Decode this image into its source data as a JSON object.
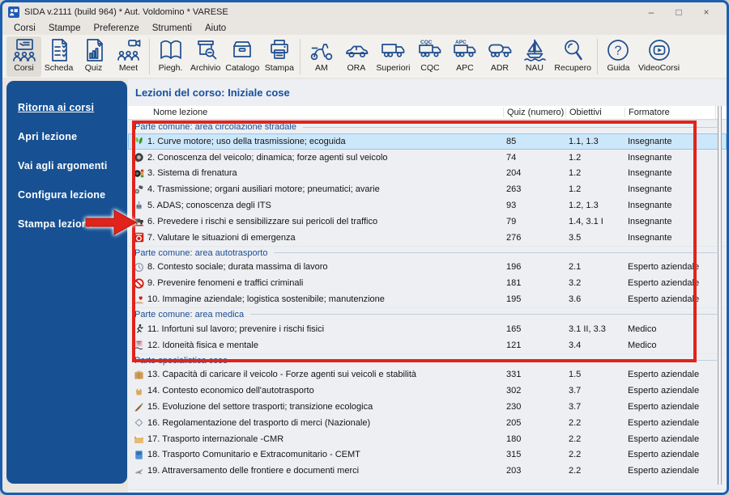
{
  "window": {
    "title": "SIDA v.2111 (build 964) * Aut. Voldomino * VARESE",
    "controls": {
      "minimize": "–",
      "maximize": "□",
      "close": "×"
    }
  },
  "menu": [
    "Corsi",
    "Stampe",
    "Preferenze",
    "Strumenti",
    "Aiuto"
  ],
  "toolbar": {
    "groups": [
      {
        "items": [
          {
            "label": "Corsi",
            "icon": "presentation-people",
            "selected": true
          },
          {
            "label": "Scheda",
            "icon": "document-check",
            "selected": false
          },
          {
            "label": "Quiz",
            "icon": "quiz-chart-document",
            "selected": false
          },
          {
            "label": "Meet",
            "icon": "video-meeting",
            "selected": false
          }
        ]
      },
      {
        "items": [
          {
            "label": "Piegh.",
            "icon": "open-book",
            "selected": false
          },
          {
            "label": "Archivio",
            "icon": "archive-search",
            "selected": false
          },
          {
            "label": "Catalogo",
            "icon": "card-drawer",
            "selected": false
          },
          {
            "label": "Stampa",
            "icon": "printer",
            "selected": false
          }
        ]
      },
      {
        "items": [
          {
            "label": "AM",
            "icon": "scooter",
            "selected": false
          },
          {
            "label": "ORA",
            "icon": "car",
            "selected": false
          },
          {
            "label": "Superiori",
            "icon": "truck",
            "selected": false
          },
          {
            "label": "CQC",
            "icon": "truck-cqc",
            "selected": false
          },
          {
            "label": "APC",
            "icon": "truck-apc",
            "selected": false
          },
          {
            "label": "ADR",
            "icon": "tanker-truck",
            "selected": false
          },
          {
            "label": "NAU",
            "icon": "sailboat",
            "selected": false
          },
          {
            "label": "Recupero",
            "icon": "magnifier",
            "selected": false
          }
        ]
      },
      {
        "items": [
          {
            "label": "Guida",
            "icon": "question-circle",
            "selected": false
          },
          {
            "label": "VideoCorsi",
            "icon": "video-play-circle",
            "selected": false
          }
        ]
      }
    ]
  },
  "sidebar": {
    "items": [
      {
        "label": "Ritorna ai corsi",
        "underline": true
      },
      {
        "label": "Apri lezione",
        "underline": false
      },
      {
        "label": "Vai agli argomenti",
        "underline": false
      },
      {
        "label": "Configura lezione",
        "underline": false
      },
      {
        "label": "Stampa lezione",
        "underline": false
      }
    ]
  },
  "main": {
    "title": "Lezioni del corso: Iniziale cose",
    "columns": [
      "Nome lezione",
      "Quiz (numero)",
      "Obiettivi",
      "Formatore"
    ],
    "rows": [
      {
        "kind": "group",
        "label": "Parte comune: area circolazione stradale"
      },
      {
        "kind": "lesson",
        "icon": "eco-leaves",
        "name": "1. Curve motore; uso della trasmissione; ecoguida",
        "quiz": "85",
        "obiettivi": "1.1, 1.3",
        "formatore": "Insegnante",
        "selected": true
      },
      {
        "kind": "lesson",
        "icon": "steering-wheel",
        "name": "2. Conoscenza del veicolo; dinamica; forze agenti sul veicolo",
        "quiz": "74",
        "obiettivi": "1.2",
        "formatore": "Insegnante",
        "selected": false
      },
      {
        "kind": "lesson",
        "icon": "tire-traffic-light",
        "name": "3. Sistema di frenatura",
        "quiz": "204",
        "obiettivi": "1.2",
        "formatore": "Insegnante",
        "selected": false
      },
      {
        "kind": "lesson",
        "icon": "mechanical-parts",
        "name": "4. Trasmissione; organi ausiliari motore; pneumatici; avarie",
        "quiz": "263",
        "obiettivi": "1.2",
        "formatore": "Insegnante",
        "selected": false
      },
      {
        "kind": "lesson",
        "icon": "adas-robot",
        "name": "5. ADAS; conoscenza degli ITS",
        "quiz": "93",
        "obiettivi": "1.2, 1.3",
        "formatore": "Insegnante",
        "selected": false
      },
      {
        "kind": "lesson",
        "icon": "truck-hazard",
        "name": "6. Prevedere i rischi e sensibilizzare sui pericoli del traffico",
        "quiz": "79",
        "obiettivi": "1.4, 3.1 I",
        "formatore": "Insegnante",
        "selected": false
      },
      {
        "kind": "lesson",
        "icon": "emergency-sign",
        "name": "7. Valutare le situazioni di emergenza",
        "quiz": "276",
        "obiettivi": "3.5",
        "formatore": "Insegnante",
        "selected": false
      },
      {
        "kind": "group",
        "label": "Parte comune: area autotrasporto"
      },
      {
        "kind": "lesson",
        "icon": "clock",
        "name": "8. Contesto sociale; durata massima di lavoro",
        "quiz": "196",
        "obiettivi": "2.1",
        "formatore": "Esperto aziendale",
        "selected": false
      },
      {
        "kind": "lesson",
        "icon": "no-entry",
        "name": "9. Prevenire fenomeni e traffici criminali",
        "quiz": "181",
        "obiettivi": "3.2",
        "formatore": "Esperto aziendale",
        "selected": false
      },
      {
        "kind": "lesson",
        "icon": "hand-heart",
        "name": "10. Immagine aziendale; logistica sostenibile; manutenzione",
        "quiz": "195",
        "obiettivi": "3.6",
        "formatore": "Esperto aziendale",
        "selected": false
      },
      {
        "kind": "group",
        "label": "Parte comune: area medica"
      },
      {
        "kind": "lesson",
        "icon": "runner",
        "name": "11. Infortuni sul lavoro; prevenire i rischi fisici",
        "quiz": "165",
        "obiettivi": "3.1 II, 3.3",
        "formatore": "Medico",
        "selected": false
      },
      {
        "kind": "lesson",
        "icon": "eye-test",
        "name": "12. Idoneità fisica e mentale",
        "quiz": "121",
        "obiettivi": "3.4",
        "formatore": "Medico",
        "selected": false
      },
      {
        "kind": "group",
        "label": "Parte specialistica cose"
      },
      {
        "kind": "lesson",
        "icon": "cargo-box",
        "name": "13. Capacità di caricare il veicolo - Forze agenti sui veicoli e stabilità",
        "quiz": "331",
        "obiettivi": "1.5",
        "formatore": "Esperto aziendale",
        "selected": false
      },
      {
        "kind": "lesson",
        "icon": "basket",
        "name": "14. Contesto economico dell'autotrasporto",
        "quiz": "302",
        "obiettivi": "3.7",
        "formatore": "Esperto aziendale",
        "selected": false
      },
      {
        "kind": "lesson",
        "icon": "eco-pen",
        "name": "15. Evoluzione del settore trasporti; transizione ecologica",
        "quiz": "230",
        "obiettivi": "3.7",
        "formatore": "Esperto aziendale",
        "selected": false
      },
      {
        "kind": "lesson",
        "icon": "diamond",
        "name": "16. Regolamentazione del trasporto di merci (Nazionale)",
        "quiz": "205",
        "obiettivi": "2.2",
        "formatore": "Esperto aziendale",
        "selected": false
      },
      {
        "kind": "lesson",
        "icon": "folder",
        "name": "17. Trasporto internazionale -CMR",
        "quiz": "180",
        "obiettivi": "2.2",
        "formatore": "Esperto aziendale",
        "selected": false
      },
      {
        "kind": "lesson",
        "icon": "blue-book",
        "name": "18. Trasporto Comunitario e Extracomunitario - CEMT",
        "quiz": "315",
        "obiettivi": "2.2",
        "formatore": "Esperto aziendale",
        "selected": false
      },
      {
        "kind": "lesson",
        "icon": "bird",
        "name": "19. Attraversamento delle frontiere e documenti merci",
        "quiz": "203",
        "obiettivi": "2.2",
        "formatore": "Esperto aziendale",
        "selected": false
      }
    ]
  },
  "annotations": {
    "highlight_color": "#e0241b"
  }
}
